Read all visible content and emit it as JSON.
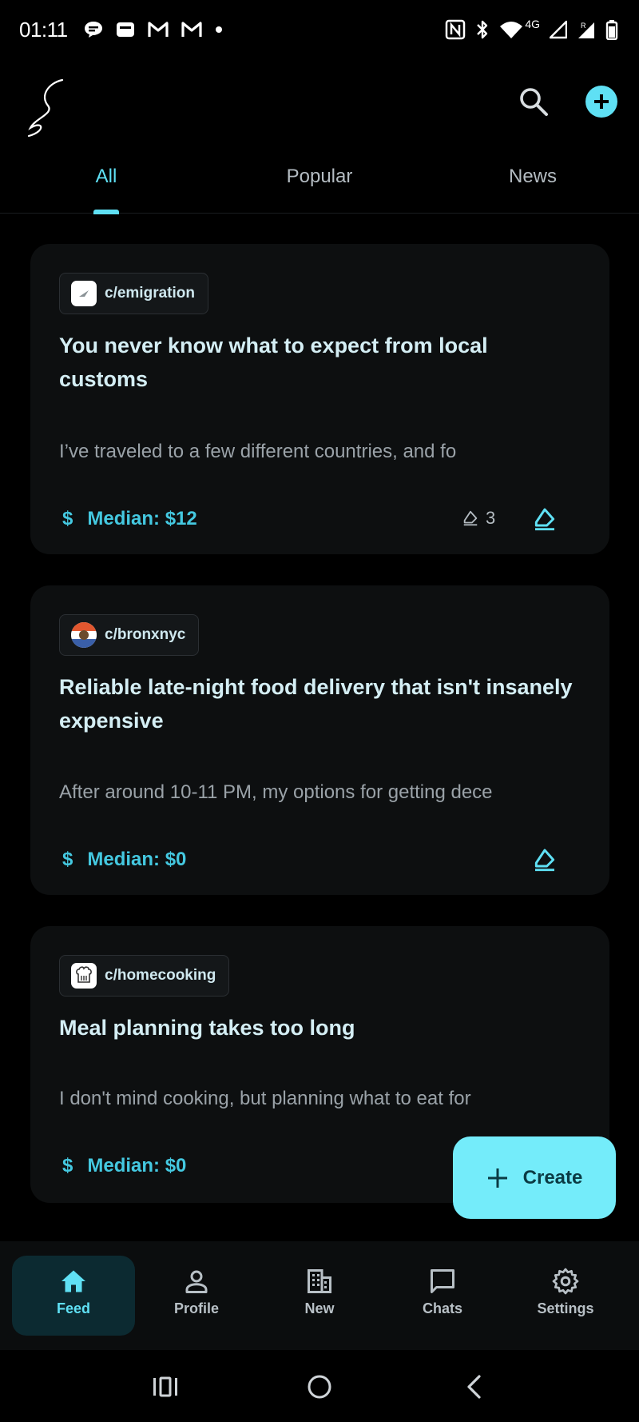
{
  "status_bar": {
    "time": "01:11",
    "network_label": "4G",
    "left_icons": [
      "chat-bubble-icon",
      "notification-icon",
      "gmail-icon",
      "gmail-icon",
      "dot-icon"
    ],
    "right_icons": [
      "nfc-icon",
      "bluetooth-icon",
      "wifi-icon",
      "signal-icon",
      "signal-roaming-icon",
      "battery-icon"
    ]
  },
  "app_bar": {
    "logo_icon": "squiggle-logo",
    "search_icon": "search-icon",
    "add_icon": "add-circle-icon"
  },
  "tabs": [
    {
      "label": "All",
      "active": true
    },
    {
      "label": "Popular",
      "active": false
    },
    {
      "label": "News",
      "active": false
    }
  ],
  "posts": [
    {
      "community": "c/emigration",
      "title": "You never know what to expect from local customs",
      "excerpt": "I’ve traveled to a few different countries, and fo",
      "median_symbol": "$",
      "median": "Median: $12",
      "bid_count": "3"
    },
    {
      "community": "c/bronxnyc",
      "title": "Reliable late-night food delivery that isn't insanely expensive",
      "excerpt": "After around 10-11 PM, my options for getting dece",
      "median_symbol": "$",
      "median": "Median: $0",
      "bid_count": ""
    },
    {
      "community": "c/homecooking",
      "title": "Meal planning takes too long",
      "excerpt": "I don't mind cooking, but planning what to eat for",
      "median_symbol": "$",
      "median": "Median: $0",
      "bid_count": ""
    }
  ],
  "fab": {
    "label": "Create",
    "icon": "plus-icon"
  },
  "bottom_nav": [
    {
      "label": "Feed",
      "icon": "home-icon",
      "active": true
    },
    {
      "label": "Profile",
      "icon": "person-icon",
      "active": false
    },
    {
      "label": "New",
      "icon": "building-icon",
      "active": false
    },
    {
      "label": "Chats",
      "icon": "chat-icon",
      "active": false
    },
    {
      "label": "Settings",
      "icon": "gear-icon",
      "active": false
    }
  ],
  "colors": {
    "background": "#000000",
    "card": "#0d0f10",
    "accent": "#5fe0f4",
    "fab": "#74ecfa",
    "title_text": "#d4eef4",
    "muted_text": "#9aa2a8"
  }
}
